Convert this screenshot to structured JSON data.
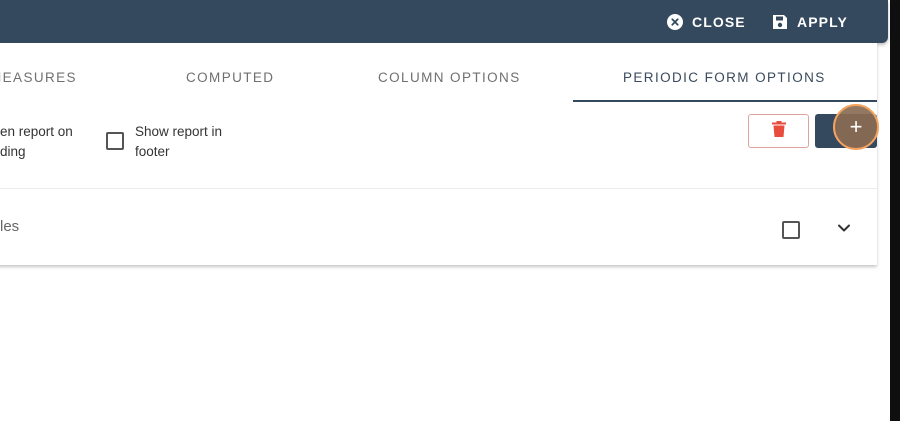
{
  "header": {
    "close_label": "CLOSE",
    "apply_label": "APPLY",
    "close_icon": "close-circle-icon",
    "apply_icon": "save-icon"
  },
  "tabs": [
    {
      "label": "MEASURES",
      "active": false
    },
    {
      "label": "COMPUTED",
      "active": false
    },
    {
      "label": "COLUMN OPTIONS",
      "active": false
    },
    {
      "label": "PERIODIC FORM OPTIONS",
      "active": true
    }
  ],
  "options": {
    "left_line1": "en report on",
    "left_line2": "ding",
    "footer_line1": "Show report in",
    "footer_line2": "footer"
  },
  "actions": {
    "delete_icon": "trash-icon",
    "add_label": "+"
  },
  "row": {
    "label": "les"
  },
  "colors": {
    "header_bg": "#34495e",
    "delete_icon": "#e74c3c",
    "highlight": "#f3a35f"
  }
}
